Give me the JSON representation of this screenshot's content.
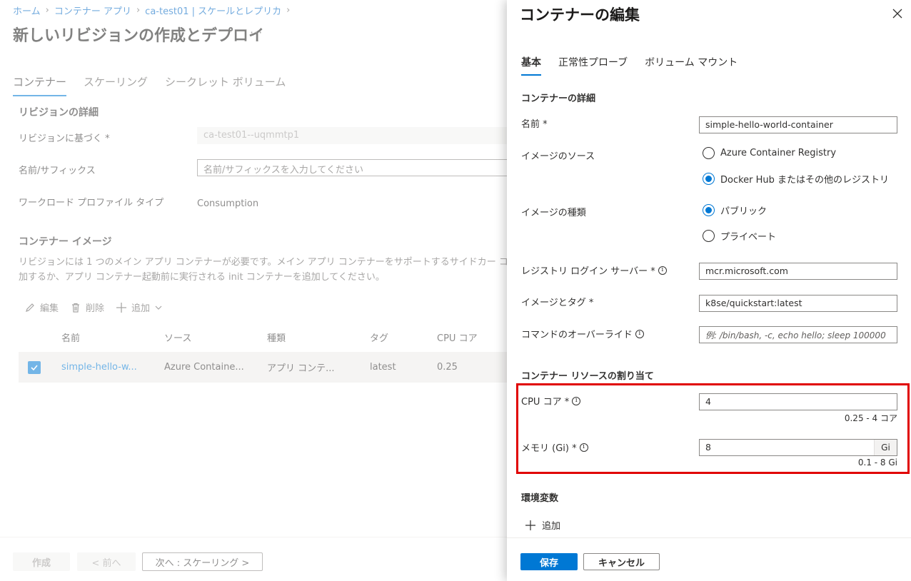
{
  "breadcrumb": [
    "ホーム",
    "コンテナー アプリ",
    "ca-test01 | スケールとレプリカ"
  ],
  "page": {
    "title": "新しいリビジョンの作成とデプロイ",
    "more": "···"
  },
  "bg_tabs": [
    "コンテナー",
    "スケーリング",
    "シークレット ボリューム"
  ],
  "revision": {
    "heading": "リビジョンの詳細",
    "based_on_label": "リビジョンに基づく *",
    "based_on_value": "ca-test01--uqmmtp1",
    "suffix_label": "名前/サフィックス",
    "suffix_placeholder": "名前/サフィックスを入力してください",
    "workload_label": "ワークロード プロファイル タイプ",
    "workload_value": "Consumption"
  },
  "container_image": {
    "heading": "コンテナー イメージ",
    "description": "リビジョンには 1 つのメイン アプリ コンテナーが必要です。メイン アプリ コンテナーをサポートするサイドカー コ 加するか、アプリ コンテナー起動前に実行される init コンテナーを追加してください。"
  },
  "commands": {
    "edit": "編集",
    "delete": "削除",
    "add": "追加"
  },
  "table": {
    "headers": [
      "名前",
      "ソース",
      "種類",
      "タグ",
      "CPU コア"
    ],
    "rows": [
      {
        "name": "simple-hello-w...",
        "source": "Azure Containe...",
        "type": "アプリ コンテ...",
        "tag": "latest",
        "cpu": "0.25",
        "selected": true
      }
    ]
  },
  "footer": {
    "create": "作成",
    "prev": "< 前へ",
    "next": "次へ : スケーリング >"
  },
  "panel": {
    "title": "コンテナーの編集",
    "tabs": [
      "基本",
      "正常性プローブ",
      "ボリューム マウント"
    ],
    "details_heading": "コンテナーの詳細",
    "name_label": "名前 *",
    "name_value": "simple-hello-world-container",
    "source_label": "イメージのソース",
    "source_options": [
      "Azure Container Registry",
      "Docker Hub またはその他のレジストリ"
    ],
    "source_selected": 1,
    "type_label": "イメージの種類",
    "type_options": [
      "パブリック",
      "プライベート"
    ],
    "type_selected": 0,
    "registry_label": "レジストリ ログイン サーバー *",
    "registry_value": "mcr.microsoft.com",
    "image_tag_label": "イメージとタグ *",
    "image_tag_value": "k8se/quickstart:latest",
    "command_label": "コマンドのオーバーライド",
    "command_placeholder": "例: /bin/bash, -c, echo hello; sleep 100000",
    "resources_heading": "コンテナー リソースの割り当て",
    "cpu_label": "CPU コア *",
    "cpu_value": "4",
    "cpu_hint": "0.25 - 4 コア",
    "memory_label": "メモリ (Gi) *",
    "memory_value": "8",
    "memory_unit": "Gi",
    "memory_hint": "0.1 - 8 Gi",
    "env_heading": "環境変数",
    "env_add": "追加",
    "save": "保存",
    "cancel": "キャンセル"
  },
  "colors": {
    "accent": "#0078d4",
    "highlight": "#e00000"
  }
}
